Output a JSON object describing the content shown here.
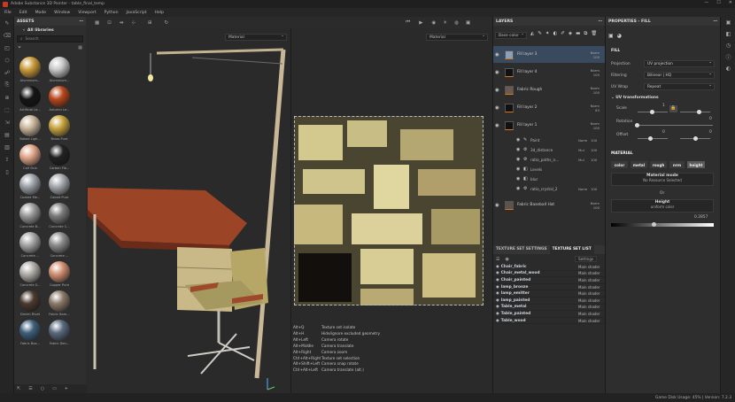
{
  "window": {
    "title": "Adobe Substance 3D Painter - table_final_temp",
    "controls": [
      "—",
      "☐",
      "✕"
    ]
  },
  "menu": [
    "File",
    "Edit",
    "Mode",
    "Window",
    "Viewport",
    "Python",
    "JavaScript",
    "Help"
  ],
  "assets": {
    "title": "ASSETS",
    "library": "All libraries",
    "search_placeholder": "Search",
    "materials": [
      {
        "label": "Aluminium...",
        "color": "#c99a3a"
      },
      {
        "label": "Aluminium...",
        "color": "#c6c6c6"
      },
      {
        "label": "Artificial Le...",
        "color": "#141414"
      },
      {
        "label": "Autumn Le...",
        "color": "#b8481c"
      },
      {
        "label": "Baked Ligh...",
        "color": "#c8b49a"
      },
      {
        "label": "Brass Pure",
        "color": "#c7a440"
      },
      {
        "label": "Calf Skin",
        "color": "#e0a58a"
      },
      {
        "label": "Carbon Fib...",
        "color": "#222222"
      },
      {
        "label": "Coated Me...",
        "color": "#9da2a8"
      },
      {
        "label": "Cobalt Pure",
        "color": "#a5a9ad"
      },
      {
        "label": "Concrete B...",
        "color": "#9a9a9a"
      },
      {
        "label": "Concrete C...",
        "color": "#7b7b7b"
      },
      {
        "label": "Concrete ...",
        "color": "#a5a5a5"
      },
      {
        "label": "Concrete ...",
        "color": "#8c8c8c"
      },
      {
        "label": "Concrete S...",
        "color": "#b0ada8"
      },
      {
        "label": "Copper Pure",
        "color": "#d08f72"
      },
      {
        "label": "Denim Rivet",
        "color": "#4a3a30"
      },
      {
        "label": "Fabric Bam...",
        "color": "#8a7a6a"
      },
      {
        "label": "Fabric Bas...",
        "color": "#3f5f7a"
      },
      {
        "label": "Fabric Den...",
        "color": "#5a6a7e"
      }
    ]
  },
  "viewport": {
    "left_dropdown": "Material",
    "right_dropdown": "Material",
    "shortcuts": [
      {
        "key": "Alt+Q",
        "action": "Texture set isolate"
      },
      {
        "key": "Alt+H",
        "action": "Hide/ignore excluded geometry"
      },
      {
        "key": "",
        "action": ""
      },
      {
        "key": "Alt+Left",
        "action": "Camera rotate"
      },
      {
        "key": "Alt+Middle",
        "action": "Camera translate"
      },
      {
        "key": "Alt+Right",
        "action": "Camera zoom"
      },
      {
        "key": "Ctrl+Alt+Right",
        "action": "Texture set selection"
      },
      {
        "key": "Alt+Shift+Left",
        "action": "Camera snap rotate"
      },
      {
        "key": "Ctrl+Alt+Left",
        "action": "Camera translate (alt.)"
      }
    ]
  },
  "layers": {
    "title": "LAYERS",
    "channel": "Base color",
    "items": [
      {
        "name": "Fill layer 3",
        "blend": "Norm",
        "opacity": "100",
        "thumb": "#222222"
      },
      {
        "name": "Fill layer 4",
        "blend": "Norm",
        "opacity": "100",
        "thumb": "#1a1a1a"
      },
      {
        "name": "Fabric Rough",
        "blend": "Norm",
        "opacity": "100",
        "thumb": "#6a5a50"
      },
      {
        "name": "Fill layer 2",
        "blend": "Norm",
        "opacity": "63",
        "thumb": "#0e0e0e"
      },
      {
        "name": "Fill layer 1",
        "blend": "Norm",
        "opacity": "100",
        "thumb": "#151515"
      }
    ],
    "effects": [
      {
        "name": "Paint",
        "blend": "Norm",
        "opacity": "100"
      },
      {
        "name": "3d_distance",
        "blend": "Mul",
        "opacity": "100"
      },
      {
        "name": "ratio_paths_n...",
        "blend": "Mul",
        "opacity": "100"
      },
      {
        "name": "Levels",
        "blend": "",
        "opacity": ""
      },
      {
        "name": "blur",
        "blend": "",
        "opacity": ""
      },
      {
        "name": "ratio_crystal_2",
        "blend": "Norm",
        "opacity": "100"
      }
    ],
    "bottom_item": {
      "name": "Fabric Baseball Hat",
      "blend": "Norm",
      "opacity": "100"
    }
  },
  "texture_sets": {
    "tab_settings": "TEXTURE SET SETTINGS",
    "tab_list": "TEXTURE SET LIST",
    "settings_btn": "Settings",
    "rows": [
      {
        "name": "Chair_fabric",
        "shader": "Main shader"
      },
      {
        "name": "Chair_metal_wood",
        "shader": "Main shader"
      },
      {
        "name": "Chair_painted",
        "shader": "Main shader"
      },
      {
        "name": "lamp_bronze",
        "shader": "Main shader"
      },
      {
        "name": "lamp_emitter",
        "shader": "Main shader"
      },
      {
        "name": "lamp_painted",
        "shader": "Main shader"
      },
      {
        "name": "Table_metal",
        "shader": "Main shader"
      },
      {
        "name": "Table_painted",
        "shader": "Main shader"
      },
      {
        "name": "Table_wood",
        "shader": "Main shader"
      }
    ]
  },
  "properties": {
    "title": "PROPERTIES - FILL",
    "fill_header": "FILL",
    "projection_label": "Projection",
    "projection_value": "UV projection",
    "filtering_label": "Filtering",
    "filtering_value": "Bilinear | HQ",
    "uvwrap_label": "UV Wrap",
    "uvwrap_value": "Repeat",
    "uvtrans_header": "UV transformations",
    "scale_label": "Scale",
    "scale_value": "1",
    "rotation_label": "Rotation",
    "rotation_value": "0",
    "offset_label": "Offset",
    "offset_x": "0",
    "offset_y": "0",
    "material_header": "MATERIAL",
    "channels": [
      "color",
      "metal",
      "rough",
      "nrm",
      "height"
    ],
    "material_mode": "Material mode",
    "no_resource": "No Resource Selected",
    "or": "Or",
    "height": "Height",
    "uniform": "uniform color",
    "height_value": "0.2857",
    "height_level": 0.42,
    "accent": "#e0760f"
  },
  "status": "Game Disk Usage: 45% | Version: 7.2.3"
}
